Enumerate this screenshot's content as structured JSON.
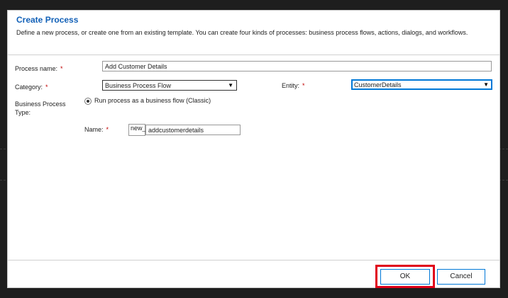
{
  "dialog": {
    "title": "Create Process",
    "subtitle": "Define a new process, or create one from an existing template. You can create four kinds of processes: business process flows, actions, dialogs, and workflows."
  },
  "form": {
    "process_name_label": "Process name:",
    "process_name_value": "Add Customer Details",
    "category_label": "Category:",
    "category_value": "Business Process Flow",
    "entity_label": "Entity:",
    "entity_value": "CustomerDetails",
    "type_label_line1": "Business Process",
    "type_label_line2": "Type:",
    "type_option": "Run process as a business flow (Classic)",
    "name_label": "Name:",
    "name_prefix": "new_",
    "name_value": "addcustomerdetails",
    "required_marker": "*"
  },
  "buttons": {
    "ok": "OK",
    "cancel": "Cancel"
  },
  "icons": {
    "dropdown": "chevron-down-icon",
    "radio": "radio-icon"
  },
  "colors": {
    "title": "#1160b7",
    "accent": "#0078d7",
    "required": "#c00000",
    "highlight": "#e0001a"
  }
}
